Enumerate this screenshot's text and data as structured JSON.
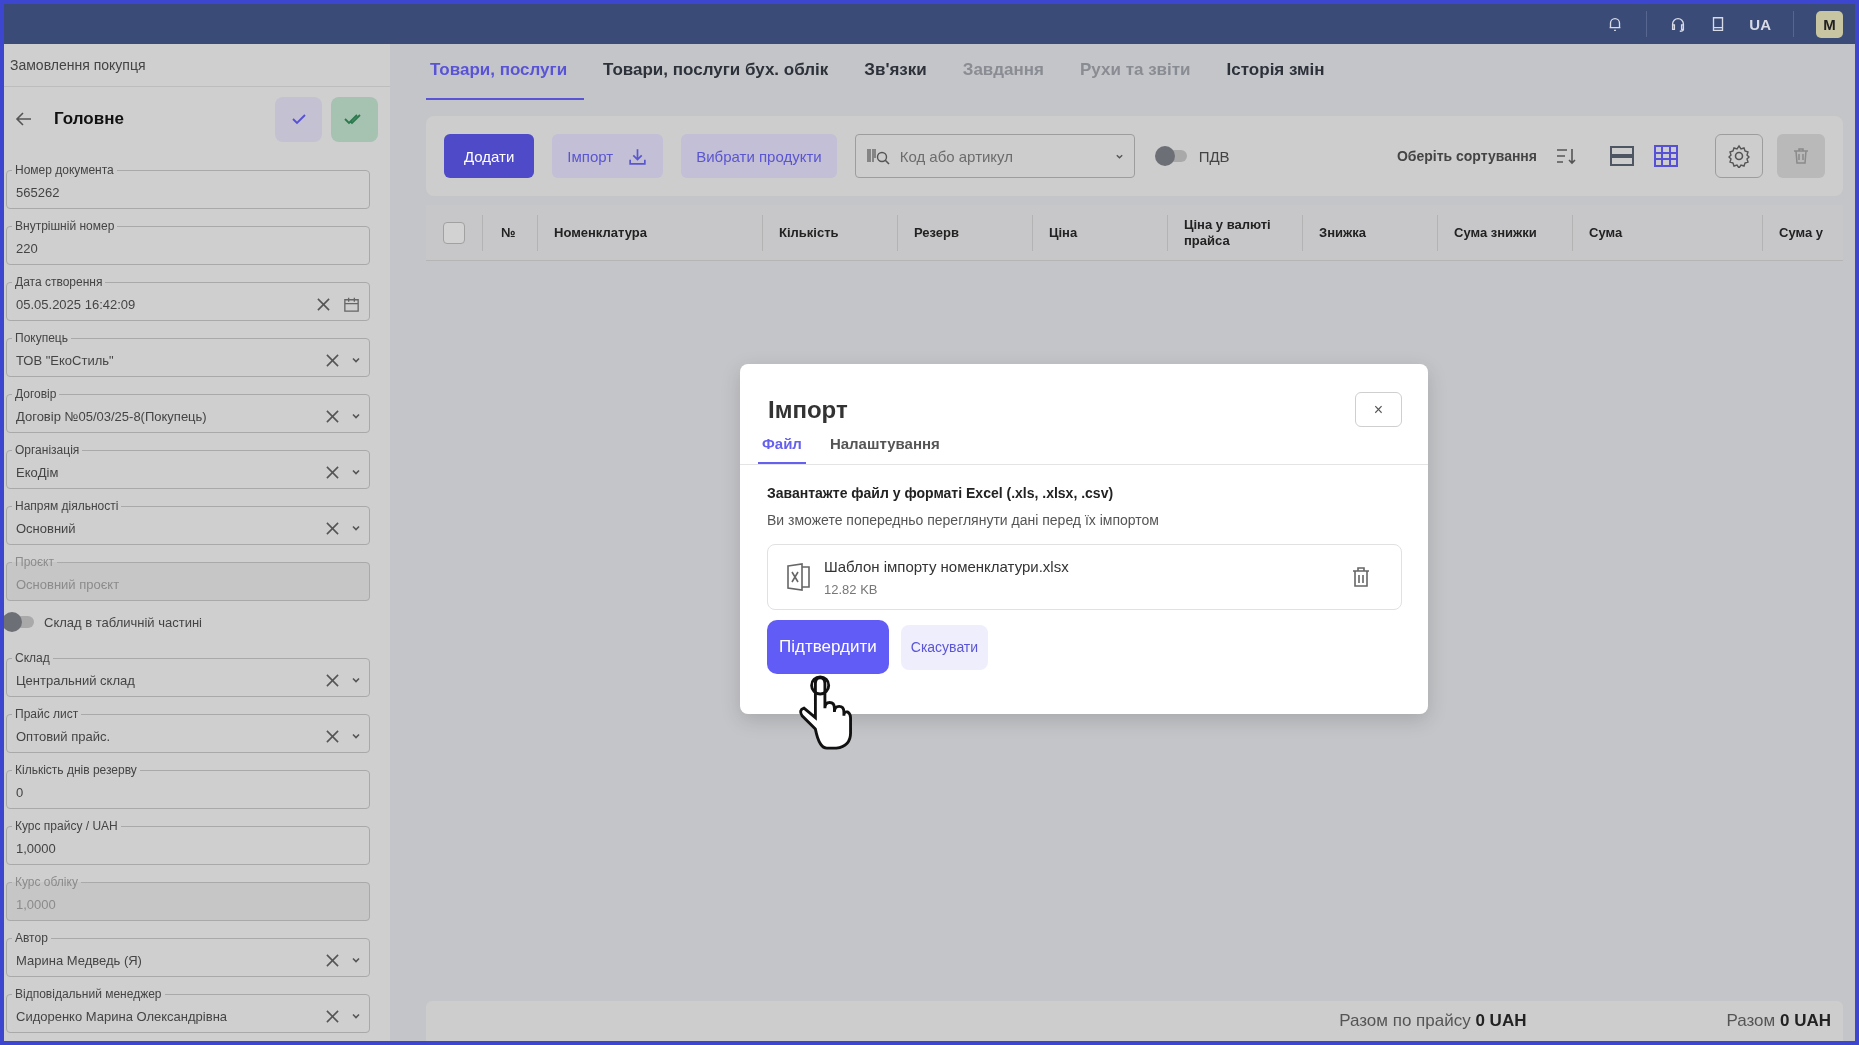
{
  "top_bar": {
    "language": "UA",
    "avatar": "M"
  },
  "sidebar": {
    "breadcrumb": "Замовлення покупця",
    "title": "Головне",
    "fields": [
      {
        "kind": "text",
        "label": "Номер документа",
        "value": "565262"
      },
      {
        "kind": "text",
        "label": "Внутрішній номер",
        "value": "220"
      },
      {
        "kind": "date",
        "label": "Дата створення",
        "value": "05.05.2025 16:42:09"
      },
      {
        "kind": "select",
        "label": "Покупець",
        "value": "ТОВ \"ЕкоСтиль\""
      },
      {
        "kind": "select",
        "label": "Договір",
        "value": "Договір №05/03/25-8(Покупець)"
      },
      {
        "kind": "select",
        "label": "Організація",
        "value": "ЕкоДім"
      },
      {
        "kind": "select",
        "label": "Напрям діяльності",
        "value": "Основний"
      },
      {
        "kind": "disabled",
        "label": "Проєкт",
        "value": "Основний проєкт"
      },
      {
        "kind": "toggle",
        "label": "Склад в табличній частині",
        "on": false
      },
      {
        "kind": "select",
        "label": "Склад",
        "value": "Центральний склад"
      },
      {
        "kind": "select",
        "label": "Прайс лист",
        "value": "Оптовий прайс."
      },
      {
        "kind": "text",
        "label": "Кількість днів резерву",
        "value": "0"
      },
      {
        "kind": "text",
        "label": "Курс прайсу / UAH",
        "value": "1,0000"
      },
      {
        "kind": "disabled",
        "label": "Курс обліку",
        "value": "1,0000"
      },
      {
        "kind": "select",
        "label": "Автор",
        "value": "Марина Медведь (Я)"
      },
      {
        "kind": "select",
        "label": "Відповідальний менеджер",
        "value": "Сидоренко Марина Олександрівна"
      }
    ]
  },
  "tabs": [
    {
      "label": "Товари, послуги",
      "selected": true,
      "disabled": false
    },
    {
      "label": "Товари, послуги бух. облік",
      "selected": false,
      "disabled": false
    },
    {
      "label": "Зв'язки",
      "selected": false,
      "disabled": false
    },
    {
      "label": "Завдання",
      "selected": false,
      "disabled": true
    },
    {
      "label": "Рухи та звіти",
      "selected": false,
      "disabled": true
    },
    {
      "label": "Історія змін",
      "selected": false,
      "disabled": false
    }
  ],
  "toolbar": {
    "add_button": "Додати",
    "import_button": "Імпорт",
    "select_products_button": "Вибрати продукти",
    "search": {
      "placeholder": "Код або артикул"
    },
    "vat_toggle": {
      "label": "ПДВ",
      "on": false
    },
    "sort_label": "Оберіть сортування",
    "views": [
      {
        "kind": "rows",
        "selected": false
      },
      {
        "kind": "grid",
        "selected": true
      }
    ]
  },
  "table": {
    "header_checkbox": {
      "checked": false
    },
    "columns": [
      "№",
      "Номенклатура",
      "Кількість",
      "Резерв",
      "Ціна",
      "Ціна у валюті прайса",
      "Знижка",
      "Сума знижки",
      "Сума",
      "Сума у"
    ]
  },
  "totals": [
    {
      "label": "Разом по прайсу",
      "value": "0 UAH"
    },
    {
      "label": "Разом",
      "value": "0 UAH"
    }
  ],
  "dialog": {
    "title": "Імпорт",
    "close": "×",
    "tabs": [
      {
        "label": "Файл",
        "selected": true
      },
      {
        "label": "Налаштування",
        "selected": false
      }
    ],
    "heading": "Завантажте файл у форматі Excel (.xls, .xlsx, .csv)",
    "description": "Ви зможете попередньо переглянути дані перед їх імпортом",
    "file": {
      "name": "Шаблон імпорту номенклатури.xlsx",
      "size": "12.82 KB"
    },
    "confirm_button": "Підтвердити",
    "cancel_button": "Скасувати"
  }
}
